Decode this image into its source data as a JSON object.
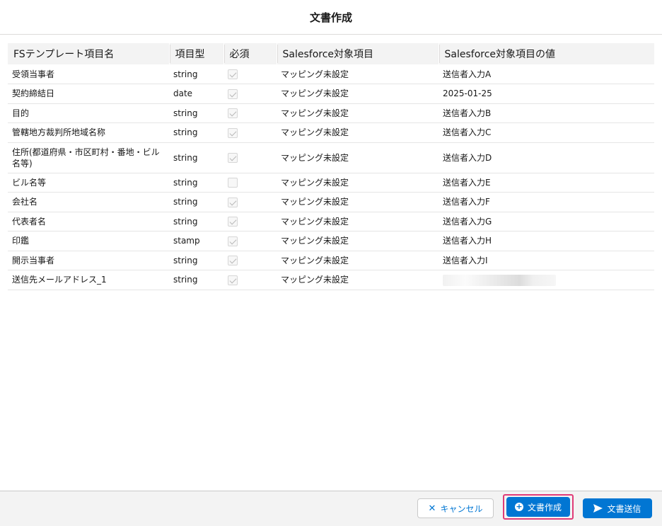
{
  "modal": {
    "title": "文書作成"
  },
  "table": {
    "headers": [
      "FSテンプレート項目名",
      "項目型",
      "必須",
      "Salesforce対象項目",
      "Salesforce対象項目の値"
    ],
    "rows": [
      {
        "name": "受領当事者",
        "type": "string",
        "required": true,
        "sf_field": "マッピング未設定",
        "sf_value": "送信者入力A"
      },
      {
        "name": "契約締結日",
        "type": "date",
        "required": true,
        "sf_field": "マッピング未設定",
        "sf_value": "2025-01-25"
      },
      {
        "name": "目的",
        "type": "string",
        "required": true,
        "sf_field": "マッピング未設定",
        "sf_value": "送信者入力B"
      },
      {
        "name": "管轄地方裁判所地域名称",
        "type": "string",
        "required": true,
        "sf_field": "マッピング未設定",
        "sf_value": "送信者入力C"
      },
      {
        "name": "住所(都道府県・市区町村・番地・ビル名等)",
        "type": "string",
        "required": true,
        "sf_field": "マッピング未設定",
        "sf_value": "送信者入力D"
      },
      {
        "name": "ビル名等",
        "type": "string",
        "required": false,
        "sf_field": "マッピング未設定",
        "sf_value": "送信者入力E"
      },
      {
        "name": "会社名",
        "type": "string",
        "required": true,
        "sf_field": "マッピング未設定",
        "sf_value": "送信者入力F"
      },
      {
        "name": "代表者名",
        "type": "string",
        "required": true,
        "sf_field": "マッピング未設定",
        "sf_value": "送信者入力G"
      },
      {
        "name": "印鑑",
        "type": "stamp",
        "required": true,
        "sf_field": "マッピング未設定",
        "sf_value": "送信者入力H"
      },
      {
        "name": "開示当事者",
        "type": "string",
        "required": true,
        "sf_field": "マッピング未設定",
        "sf_value": "送信者入力I"
      },
      {
        "name": "送信先メールアドレス_1",
        "type": "string",
        "required": true,
        "sf_field": "マッピング未設定",
        "sf_value": ""
      }
    ]
  },
  "footer": {
    "cancel_label": "キャンセル",
    "create_label": "文書作成",
    "send_label": "文書送信"
  },
  "icons": {
    "cancel": "close-icon",
    "create": "add-icon",
    "send": "send-icon"
  },
  "colors": {
    "brand": "#0176d3",
    "highlight": "#e03c78"
  }
}
